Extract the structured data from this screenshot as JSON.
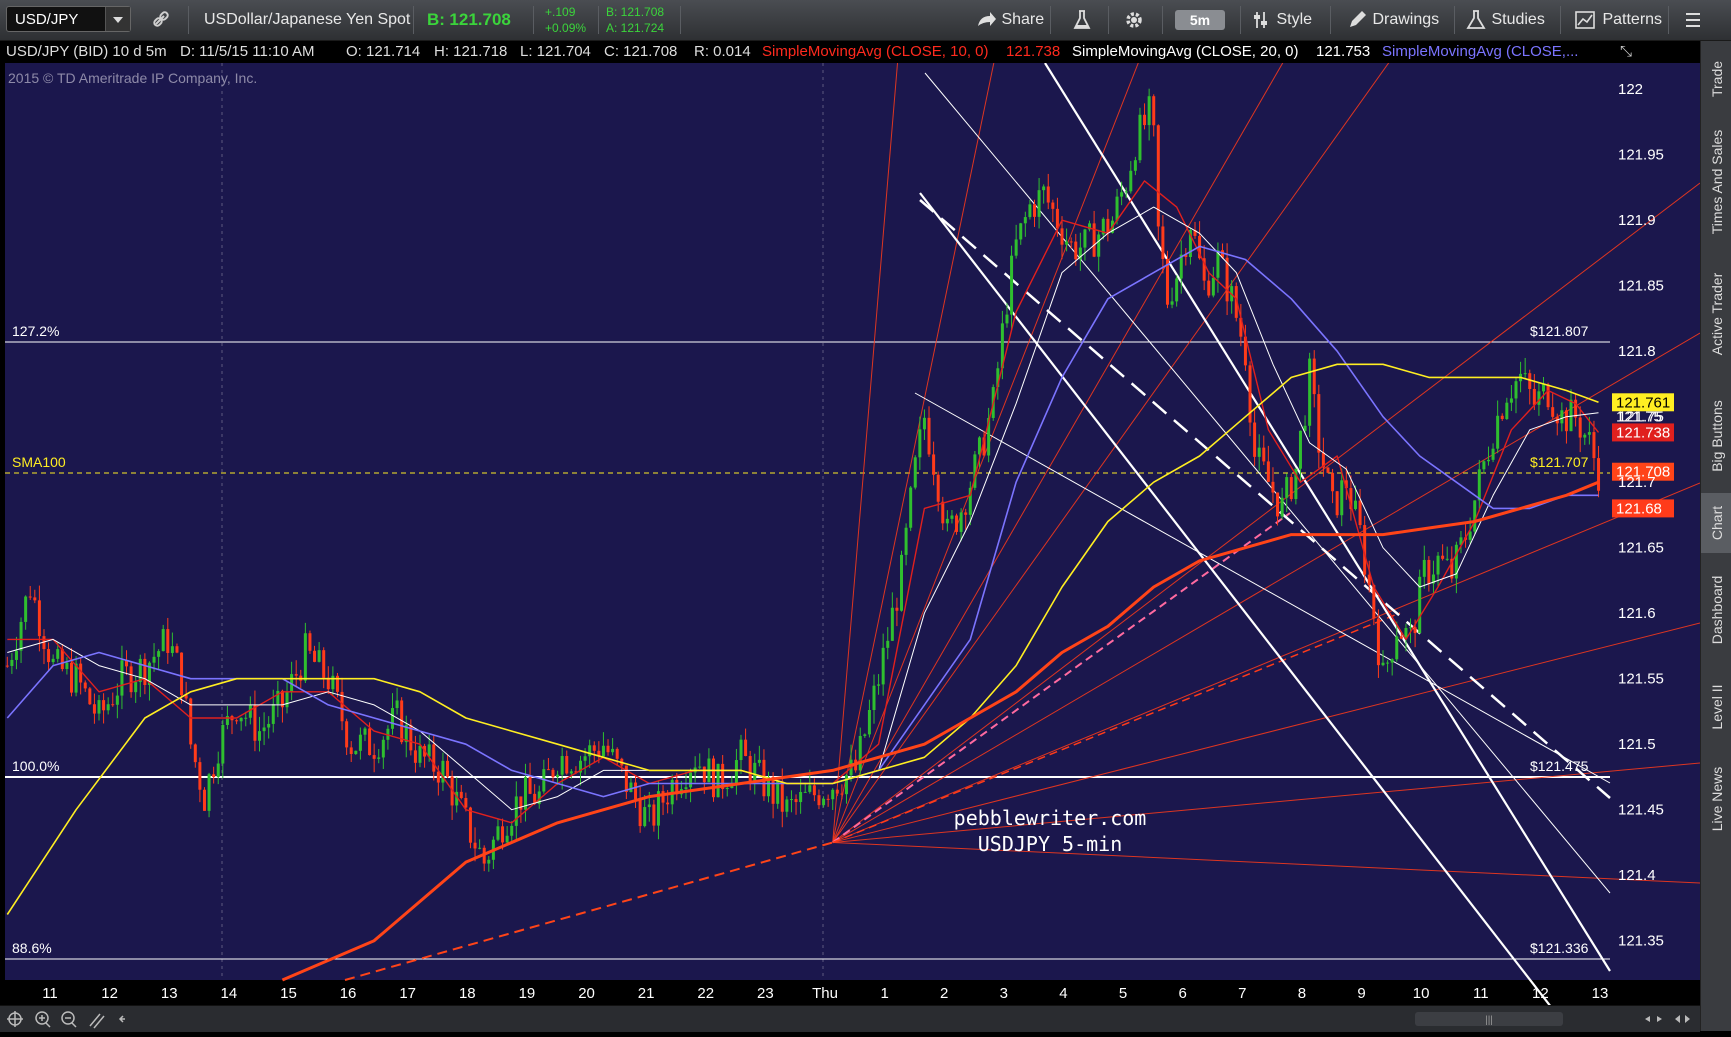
{
  "toolbar": {
    "symbol": "USD/JPY",
    "description": "USDollar/Japanese Yen Spot",
    "bid_label": "B:",
    "bid_value": "121.708",
    "change": "+.109",
    "change_pct": "+0.09%",
    "bid_small": "B: 121.708",
    "ask_small": "A: 121.724",
    "share": "Share",
    "timeframe": "5m",
    "style": "Style",
    "drawings": "Drawings",
    "studies": "Studies",
    "patterns": "Patterns"
  },
  "infobar": {
    "symbol": "USD/JPY (BID) 10 d 5m",
    "date": "D: 11/5/15 11:10 AM",
    "open": "O: 121.714",
    "high": "H: 121.718",
    "low": "L: 121.704",
    "close": "C: 121.708",
    "range": "R: 0.014",
    "sma10": "SimpleMovingAvg (CLOSE, 10, 0)",
    "sma10_val": "121.738",
    "sma20": "SimpleMovingAvg (CLOSE, 20, 0)",
    "sma20_val": "121.753",
    "sma3": "SimpleMovingAvg (CLOSE,..."
  },
  "side_tabs": [
    "Trade",
    "Times And Sales",
    "Active Trader",
    "Big Buttons",
    "Chart",
    "Dashboard",
    "Level II",
    "Live News"
  ],
  "colors": {
    "background": "#1b174d",
    "up": "#2fbf2f",
    "down": "#ff3b1a",
    "sma10": "#e0201e",
    "sma20": "#ffffff",
    "sma50": "#7b74ff",
    "sma100": "#ffee22",
    "sma200": "#ff4418"
  },
  "chart_data": {
    "type": "candlestick",
    "copyright": "2015 © TD Ameritrade IP Company, Inc.",
    "annotation_line1": "pebblewriter.com",
    "annotation_line2": "USDJPY 5-min",
    "x_ticks": [
      "11",
      "12",
      "13",
      "14",
      "15",
      "16",
      "17",
      "18",
      "19",
      "20",
      "21",
      "22",
      "23",
      "Thu",
      "1",
      "2",
      "3",
      "4",
      "5",
      "6",
      "7",
      "8",
      "9",
      "10",
      "11",
      "12",
      "13"
    ],
    "y_ticks": [
      "122",
      "121.95",
      "121.9",
      "121.85",
      "121.8",
      "121.75",
      "121.7",
      "121.65",
      "121.6",
      "121.55",
      "121.5",
      "121.45",
      "121.4",
      "121.35"
    ],
    "ylim": [
      121.32,
      122.02
    ],
    "fib_levels": [
      {
        "label": "127.2%",
        "value": 121.807,
        "value_label": "$121.807"
      },
      {
        "label": "100.0%",
        "value": 121.475,
        "value_label": "$121.475"
      },
      {
        "label": "88.6%",
        "value": 121.336,
        "value_label": "$121.336"
      }
    ],
    "sma100_marker": {
      "label": "SMA100",
      "value": 121.707,
      "value_label": "$121.707"
    },
    "price_tags": [
      {
        "text": "121.761",
        "value": 121.761,
        "color": "#ffee22",
        "text_color": "#000000"
      },
      {
        "text": "121.75",
        "value": 121.75,
        "color": "none",
        "text_color": "#ffffff"
      },
      {
        "text": "121.738",
        "value": 121.738,
        "color": "#e0201e",
        "text_color": "#ffffff"
      },
      {
        "text": "121.708",
        "value": 121.708,
        "color": "#ff4418",
        "text_color": "#ffffff"
      },
      {
        "text": "121.68",
        "value": 121.68,
        "color": "#ff3b1a",
        "text_color": "#ffffff"
      }
    ],
    "price_path": [
      [
        0,
        121.56
      ],
      [
        5,
        121.62
      ],
      [
        10,
        121.56
      ],
      [
        15,
        121.55
      ],
      [
        20,
        121.52
      ],
      [
        25,
        121.55
      ],
      [
        30,
        121.56
      ],
      [
        35,
        121.58
      ],
      [
        38,
        121.55
      ],
      [
        40,
        121.5
      ],
      [
        43,
        121.46
      ],
      [
        46,
        121.5
      ],
      [
        50,
        121.53
      ],
      [
        55,
        121.51
      ],
      [
        60,
        121.53
      ],
      [
        65,
        121.57
      ],
      [
        70,
        121.55
      ],
      [
        75,
        121.5
      ],
      [
        80,
        121.5
      ],
      [
        85,
        121.52
      ],
      [
        90,
        121.49
      ],
      [
        95,
        121.48
      ],
      [
        100,
        121.44
      ],
      [
        104,
        121.41
      ],
      [
        108,
        121.44
      ],
      [
        112,
        121.46
      ],
      [
        116,
        121.46
      ],
      [
        120,
        121.49
      ],
      [
        125,
        121.49
      ],
      [
        130,
        121.5
      ],
      [
        135,
        121.47
      ],
      [
        140,
        121.44
      ],
      [
        145,
        121.47
      ],
      [
        150,
        121.49
      ],
      [
        155,
        121.47
      ],
      [
        160,
        121.49
      ],
      [
        165,
        121.47
      ],
      [
        170,
        121.45
      ],
      [
        175,
        121.46
      ],
      [
        180,
        121.47
      ],
      [
        185,
        121.48
      ],
      [
        190,
        121.55
      ],
      [
        195,
        121.63
      ],
      [
        198,
        121.71
      ],
      [
        200,
        121.75
      ],
      [
        203,
        121.7
      ],
      [
        205,
        121.66
      ],
      [
        208,
        121.68
      ],
      [
        212,
        121.72
      ],
      [
        215,
        121.76
      ],
      [
        218,
        121.84
      ],
      [
        220,
        121.88
      ],
      [
        223,
        121.91
      ],
      [
        226,
        121.92
      ],
      [
        229,
        121.9
      ],
      [
        232,
        121.88
      ],
      [
        235,
        121.88
      ],
      [
        238,
        121.89
      ],
      [
        241,
        121.9
      ],
      [
        244,
        121.93
      ],
      [
        246,
        121.96
      ],
      [
        249,
        121.98
      ],
      [
        250,
        121.96
      ],
      [
        251,
        121.89
      ],
      [
        253,
        121.84
      ],
      [
        255,
        121.86
      ],
      [
        258,
        121.9
      ],
      [
        261,
        121.85
      ],
      [
        264,
        121.87
      ],
      [
        267,
        121.84
      ],
      [
        270,
        121.8
      ],
      [
        272,
        121.72
      ],
      [
        275,
        121.7
      ],
      [
        278,
        121.68
      ],
      [
        281,
        121.71
      ],
      [
        284,
        121.78
      ],
      [
        286,
        121.73
      ],
      [
        289,
        121.68
      ],
      [
        292,
        121.7
      ],
      [
        295,
        121.66
      ],
      [
        298,
        121.6
      ],
      [
        300,
        121.55
      ],
      [
        303,
        121.59
      ],
      [
        306,
        121.58
      ],
      [
        309,
        121.63
      ],
      [
        312,
        121.64
      ],
      [
        315,
        121.63
      ],
      [
        318,
        121.66
      ],
      [
        321,
        121.7
      ],
      [
        324,
        121.74
      ],
      [
        327,
        121.77
      ],
      [
        330,
        121.78
      ],
      [
        333,
        121.76
      ],
      [
        336,
        121.77
      ],
      [
        339,
        121.75
      ],
      [
        342,
        121.75
      ],
      [
        345,
        121.73
      ],
      [
        347,
        121.708
      ]
    ],
    "candles_per_step_note": "",
    "moving_averages": [
      {
        "name": "SMA10",
        "color_key": "sma10",
        "width": 1.4,
        "points": [
          [
            0,
            121.58
          ],
          [
            10,
            121.58
          ],
          [
            20,
            121.54
          ],
          [
            30,
            121.55
          ],
          [
            40,
            121.52
          ],
          [
            50,
            121.52
          ],
          [
            60,
            121.54
          ],
          [
            70,
            121.54
          ],
          [
            80,
            121.51
          ],
          [
            90,
            121.5
          ],
          [
            100,
            121.45
          ],
          [
            110,
            121.44
          ],
          [
            120,
            121.47
          ],
          [
            130,
            121.49
          ],
          [
            140,
            121.47
          ],
          [
            150,
            121.48
          ],
          [
            160,
            121.48
          ],
          [
            170,
            121.47
          ],
          [
            180,
            121.47
          ],
          [
            190,
            121.5
          ],
          [
            200,
            121.68
          ],
          [
            210,
            121.69
          ],
          [
            220,
            121.83
          ],
          [
            230,
            121.9
          ],
          [
            240,
            121.89
          ],
          [
            248,
            121.93
          ],
          [
            255,
            121.91
          ],
          [
            262,
            121.86
          ],
          [
            268,
            121.84
          ],
          [
            275,
            121.74
          ],
          [
            282,
            121.7
          ],
          [
            290,
            121.72
          ],
          [
            298,
            121.62
          ],
          [
            305,
            121.58
          ],
          [
            312,
            121.62
          ],
          [
            320,
            121.67
          ],
          [
            328,
            121.74
          ],
          [
            336,
            121.77
          ],
          [
            342,
            121.76
          ],
          [
            347,
            121.738
          ]
        ]
      },
      {
        "name": "SMA20",
        "color_key": "sma20",
        "width": 1.0,
        "points": [
          [
            0,
            121.57
          ],
          [
            10,
            121.58
          ],
          [
            20,
            121.56
          ],
          [
            30,
            121.55
          ],
          [
            40,
            121.53
          ],
          [
            50,
            121.53
          ],
          [
            60,
            121.53
          ],
          [
            70,
            121.54
          ],
          [
            80,
            121.53
          ],
          [
            90,
            121.51
          ],
          [
            100,
            121.48
          ],
          [
            110,
            121.45
          ],
          [
            120,
            121.46
          ],
          [
            130,
            121.48
          ],
          [
            140,
            121.48
          ],
          [
            150,
            121.48
          ],
          [
            160,
            121.48
          ],
          [
            170,
            121.47
          ],
          [
            180,
            121.47
          ],
          [
            190,
            121.48
          ],
          [
            200,
            121.6
          ],
          [
            210,
            121.67
          ],
          [
            220,
            121.76
          ],
          [
            230,
            121.86
          ],
          [
            240,
            121.89
          ],
          [
            250,
            121.91
          ],
          [
            260,
            121.89
          ],
          [
            268,
            121.86
          ],
          [
            276,
            121.79
          ],
          [
            284,
            121.73
          ],
          [
            292,
            121.71
          ],
          [
            300,
            121.65
          ],
          [
            308,
            121.62
          ],
          [
            316,
            121.63
          ],
          [
            324,
            121.69
          ],
          [
            332,
            121.74
          ],
          [
            340,
            121.75
          ],
          [
            347,
            121.753
          ]
        ]
      },
      {
        "name": "SMA50",
        "color_key": "sma50",
        "width": 1.6,
        "points": [
          [
            0,
            121.52
          ],
          [
            10,
            121.56
          ],
          [
            20,
            121.57
          ],
          [
            30,
            121.56
          ],
          [
            40,
            121.55
          ],
          [
            50,
            121.55
          ],
          [
            60,
            121.55
          ],
          [
            70,
            121.53
          ],
          [
            80,
            121.52
          ],
          [
            90,
            121.51
          ],
          [
            100,
            121.5
          ],
          [
            110,
            121.48
          ],
          [
            120,
            121.47
          ],
          [
            130,
            121.46
          ],
          [
            140,
            121.47
          ],
          [
            150,
            121.47
          ],
          [
            160,
            121.47
          ],
          [
            170,
            121.47
          ],
          [
            180,
            121.47
          ],
          [
            190,
            121.48
          ],
          [
            200,
            121.53
          ],
          [
            210,
            121.58
          ],
          [
            220,
            121.7
          ],
          [
            230,
            121.78
          ],
          [
            240,
            121.84
          ],
          [
            250,
            121.86
          ],
          [
            260,
            121.88
          ],
          [
            270,
            121.87
          ],
          [
            280,
            121.84
          ],
          [
            290,
            121.8
          ],
          [
            300,
            121.75
          ],
          [
            308,
            121.72
          ],
          [
            316,
            121.7
          ],
          [
            324,
            121.68
          ],
          [
            332,
            121.68
          ],
          [
            340,
            121.69
          ],
          [
            347,
            121.69
          ]
        ]
      },
      {
        "name": "SMA100",
        "color_key": "sma100",
        "width": 1.6,
        "points": [
          [
            0,
            121.37
          ],
          [
            15,
            121.45
          ],
          [
            30,
            121.52
          ],
          [
            40,
            121.54
          ],
          [
            50,
            121.55
          ],
          [
            60,
            121.55
          ],
          [
            70,
            121.55
          ],
          [
            80,
            121.55
          ],
          [
            90,
            121.54
          ],
          [
            100,
            121.52
          ],
          [
            110,
            121.51
          ],
          [
            120,
            121.5
          ],
          [
            130,
            121.49
          ],
          [
            140,
            121.48
          ],
          [
            150,
            121.48
          ],
          [
            160,
            121.48
          ],
          [
            170,
            121.47
          ],
          [
            180,
            121.47
          ],
          [
            190,
            121.48
          ],
          [
            200,
            121.49
          ],
          [
            210,
            121.52
          ],
          [
            220,
            121.56
          ],
          [
            230,
            121.62
          ],
          [
            240,
            121.67
          ],
          [
            250,
            121.7
          ],
          [
            260,
            121.72
          ],
          [
            270,
            121.75
          ],
          [
            280,
            121.78
          ],
          [
            290,
            121.79
          ],
          [
            300,
            121.79
          ],
          [
            310,
            121.78
          ],
          [
            320,
            121.78
          ],
          [
            330,
            121.78
          ],
          [
            340,
            121.77
          ],
          [
            347,
            121.761
          ]
        ]
      },
      {
        "name": "SMA200",
        "color_key": "sma200",
        "width": 3.0,
        "points": [
          [
            60,
            121.32
          ],
          [
            80,
            121.35
          ],
          [
            100,
            121.41
          ],
          [
            120,
            121.44
          ],
          [
            140,
            121.46
          ],
          [
            160,
            121.47
          ],
          [
            180,
            121.48
          ],
          [
            200,
            121.5
          ],
          [
            210,
            121.52
          ],
          [
            220,
            121.54
          ],
          [
            230,
            121.57
          ],
          [
            240,
            121.59
          ],
          [
            250,
            121.62
          ],
          [
            260,
            121.64
          ],
          [
            270,
            121.65
          ],
          [
            280,
            121.66
          ],
          [
            290,
            121.66
          ],
          [
            300,
            121.66
          ],
          [
            310,
            121.665
          ],
          [
            320,
            121.67
          ],
          [
            330,
            121.68
          ],
          [
            340,
            121.69
          ],
          [
            347,
            121.7
          ]
        ]
      }
    ]
  }
}
